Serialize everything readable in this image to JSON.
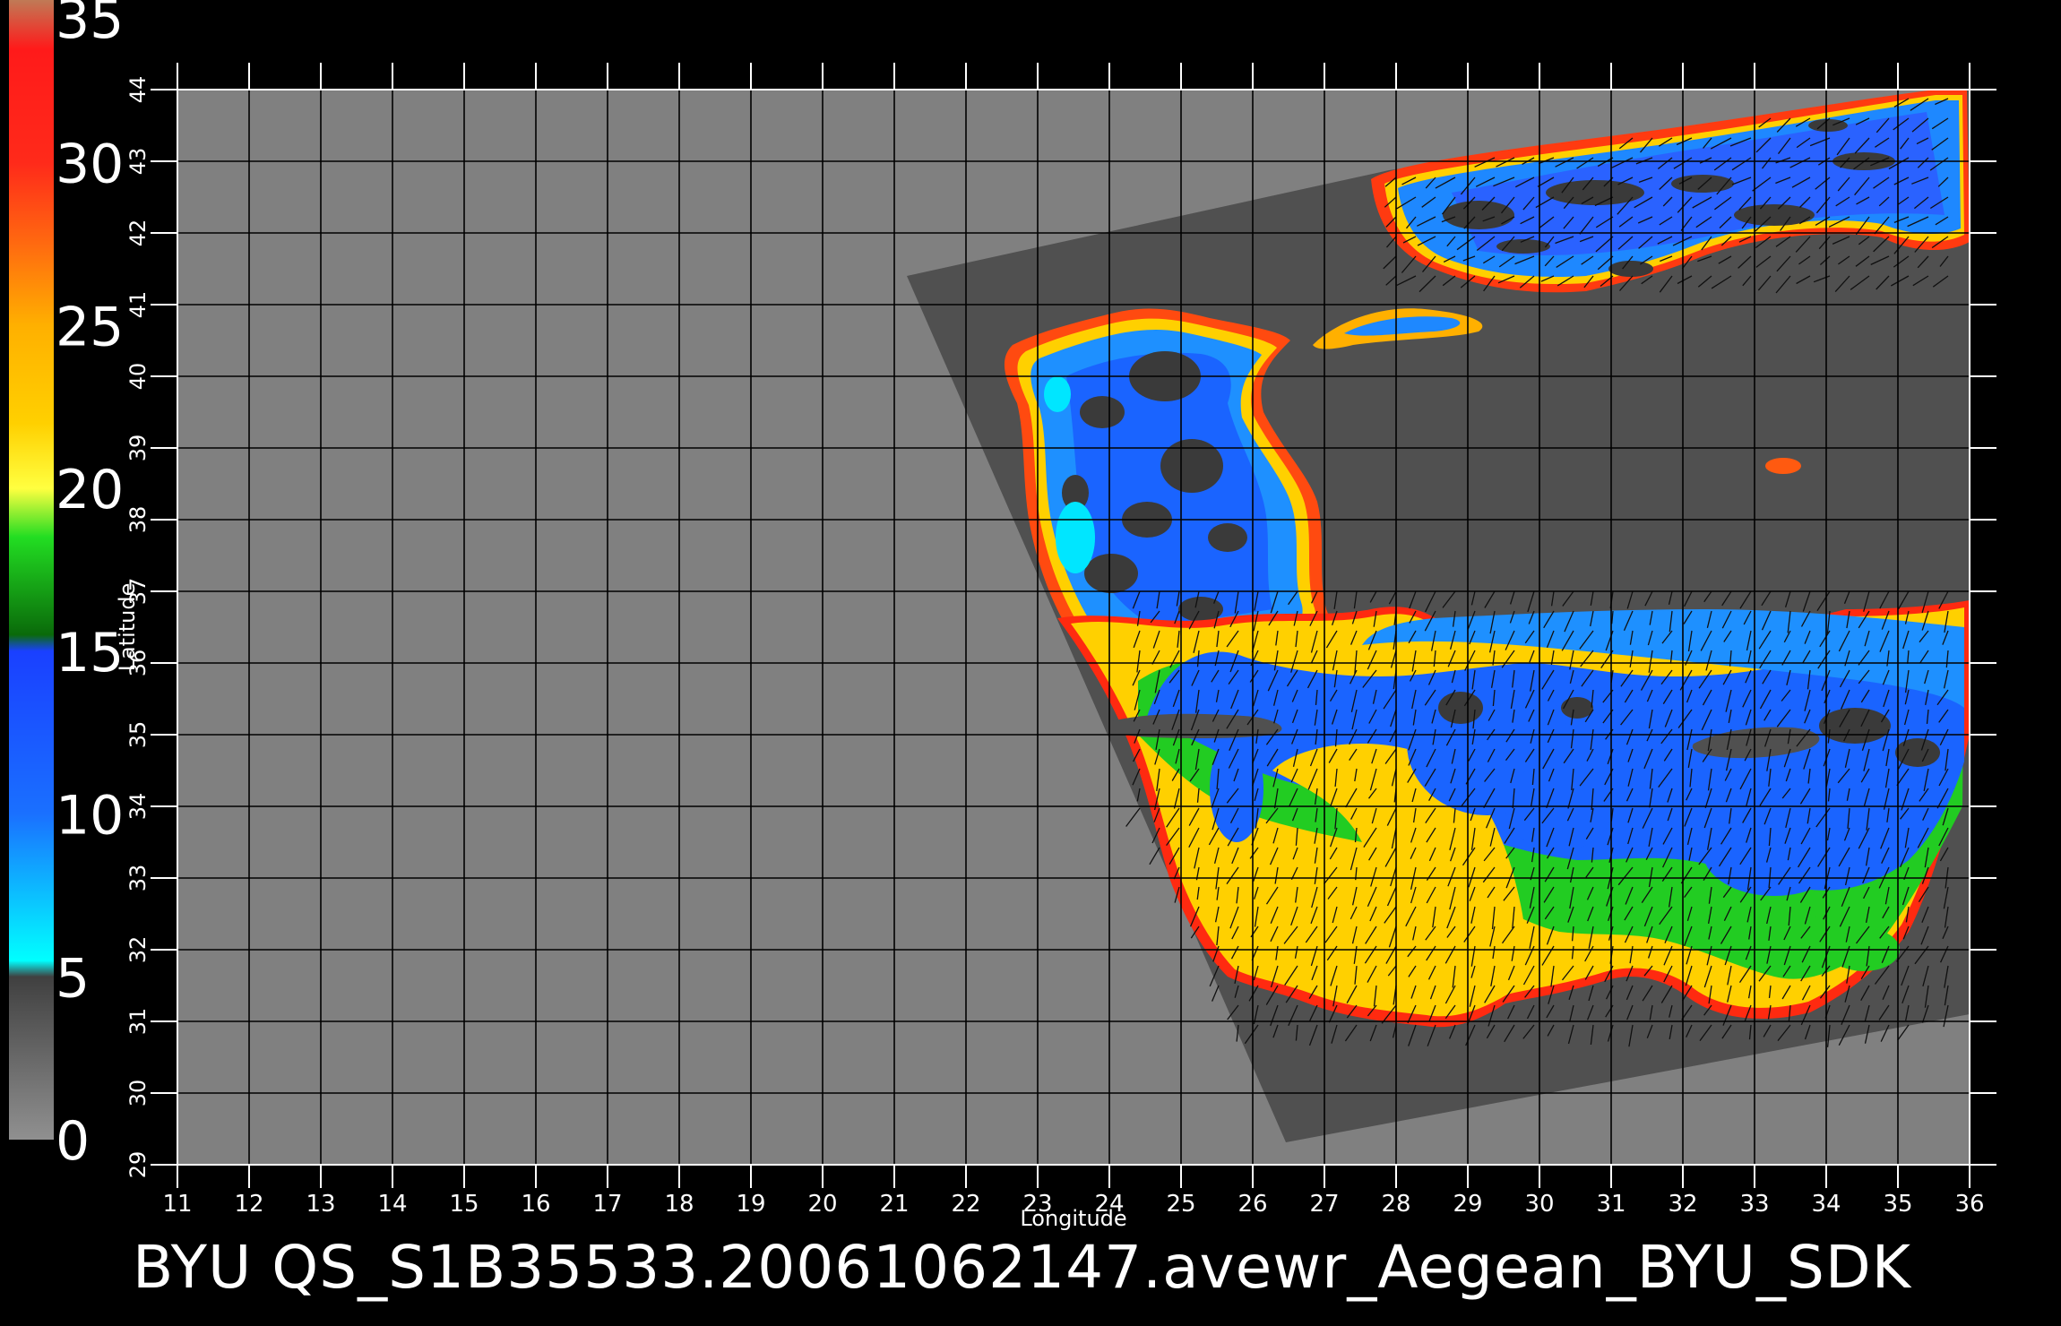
{
  "colorbar": {
    "labels": [
      "35",
      "30",
      "25",
      "20",
      "15",
      "10",
      "5",
      "0"
    ],
    "stops": [
      {
        "value": 35,
        "color": "#c07a56"
      },
      {
        "value": 33.5,
        "color": "#ff1a1a"
      },
      {
        "value": 30,
        "color": "#ff2a1a"
      },
      {
        "value": 27.5,
        "color": "#ff6a10"
      },
      {
        "value": 25,
        "color": "#ffb000"
      },
      {
        "value": 22,
        "color": "#ffd000"
      },
      {
        "value": 20,
        "color": "#ffff40"
      },
      {
        "value": 18.5,
        "color": "#22dd22"
      },
      {
        "value": 15.5,
        "color": "#0a6a0a"
      },
      {
        "value": 15,
        "color": "#1a40ff"
      },
      {
        "value": 10,
        "color": "#1a70ff"
      },
      {
        "value": 5.5,
        "color": "#00ffff"
      },
      {
        "value": 5,
        "color": "#404040"
      },
      {
        "value": 0,
        "color": "#909090"
      }
    ]
  },
  "map": {
    "longitude_ticks": [
      "11",
      "12",
      "13",
      "14",
      "15",
      "16",
      "17",
      "18",
      "19",
      "20",
      "21",
      "22",
      "23",
      "24",
      "25",
      "26",
      "27",
      "28",
      "29",
      "30",
      "31",
      "32",
      "33",
      "34",
      "35",
      "36"
    ],
    "latitude_ticks": [
      "29",
      "30",
      "31",
      "32",
      "33",
      "34",
      "35",
      "36",
      "37",
      "38",
      "39",
      "40",
      "41",
      "42",
      "43",
      "44"
    ],
    "lon_range": [
      11,
      36
    ],
    "lat_range": [
      29,
      44
    ],
    "xlabel": "Longitude",
    "ylabel": "Latitude",
    "colors": {
      "background": "#000000",
      "outside_swath": "#808080",
      "land": "#505050",
      "grid": "#000000",
      "frame": "#ffffff"
    }
  },
  "footer": {
    "title": "BYU  QS_S1B35533.20061062147.avewr_Aegean_BYU_SDK"
  }
}
